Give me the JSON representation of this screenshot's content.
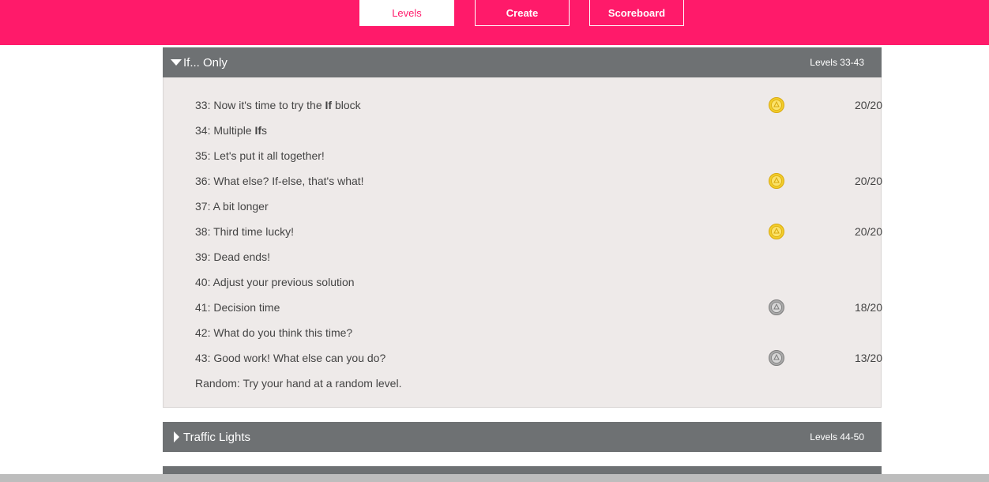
{
  "nav": {
    "levels": "Levels",
    "create": "Create",
    "scoreboard": "Scoreboard"
  },
  "episodes": [
    {
      "title": "If... Only",
      "range": "Levels 33-43",
      "expanded": true
    },
    {
      "title": "Traffic Lights",
      "range": "Levels 44-50",
      "expanded": false
    },
    {
      "title": "",
      "range": "",
      "expanded": false
    }
  ],
  "levels": [
    {
      "pre": "33: Now it's time to try the ",
      "bold": "If",
      "post": " block",
      "medal": "gold",
      "score": "20/20"
    },
    {
      "pre": "34: Multiple ",
      "bold": "If",
      "post": "s",
      "medal": "",
      "score": ""
    },
    {
      "pre": "35: Let's put it all together!",
      "bold": "",
      "post": "",
      "medal": "",
      "score": ""
    },
    {
      "pre": "36: What else? If-else, that's what!",
      "bold": "",
      "post": "",
      "medal": "gold",
      "score": "20/20"
    },
    {
      "pre": "37: A bit longer",
      "bold": "",
      "post": "",
      "medal": "",
      "score": ""
    },
    {
      "pre": "38: Third time lucky!",
      "bold": "",
      "post": "",
      "medal": "gold",
      "score": "20/20"
    },
    {
      "pre": "39: Dead ends!",
      "bold": "",
      "post": "",
      "medal": "",
      "score": ""
    },
    {
      "pre": "40: Adjust your previous solution",
      "bold": "",
      "post": "",
      "medal": "",
      "score": ""
    },
    {
      "pre": "41: Decision time",
      "bold": "",
      "post": "",
      "medal": "silver",
      "score": "18/20"
    },
    {
      "pre": "42: What do you think this time?",
      "bold": "",
      "post": "",
      "medal": "",
      "score": ""
    },
    {
      "pre": "43: Good work! What else can you do?",
      "bold": "",
      "post": "",
      "medal": "silver",
      "score": "13/20"
    },
    {
      "pre": "Random: Try your hand at a random level.",
      "bold": "",
      "post": "",
      "medal": "",
      "score": ""
    }
  ],
  "colors": {
    "brand": "#ff1a6a",
    "header": "#6e7173",
    "panel": "#eeeae9",
    "gold": "#f2cd2a",
    "silver": "#a9a9a9"
  },
  "icons": {
    "expanded": "caret-down-icon",
    "collapsed": "caret-right-icon",
    "gold": "gold-coin-icon",
    "silver": "silver-coin-icon"
  }
}
